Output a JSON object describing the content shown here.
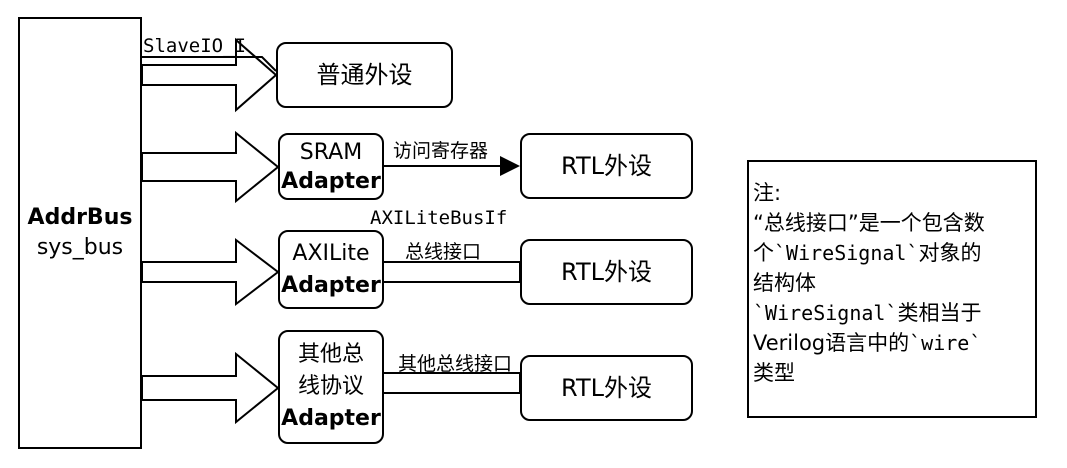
{
  "addrbus": {
    "line1": "AddrBus",
    "line2": "sys_bus"
  },
  "slave_io_label": "SlaveIO_I",
  "normal_peripheral": "普通外设",
  "sram_adapter": {
    "line1": "SRAM",
    "line2": "Adapter"
  },
  "access_register_label": "访问寄存器",
  "axilite_adapter": {
    "line1": "AXILite",
    "line2": "Adapter"
  },
  "axilite_busif_label": "AXILiteBusIf",
  "bus_interface_label": "总线接口",
  "other_adapter": {
    "line1": "其他总",
    "line2": "线协议",
    "line3": "Adapter"
  },
  "other_bus_interface_label": "其他总线接口",
  "rtl_peripheral": "RTL外设",
  "note": {
    "line1": "注:",
    "line2": "“总线接口”是一个包含数",
    "line3_pre": "个",
    "line3_code": "`WireSignal`",
    "line3_post": "对象的",
    "line4": "结构体",
    "line5_code": "`WireSignal`",
    "line5_post": "类相当于",
    "line6_pre": "Verilog语言中的",
    "line6_code": "`wire`",
    "line7": "类型"
  }
}
